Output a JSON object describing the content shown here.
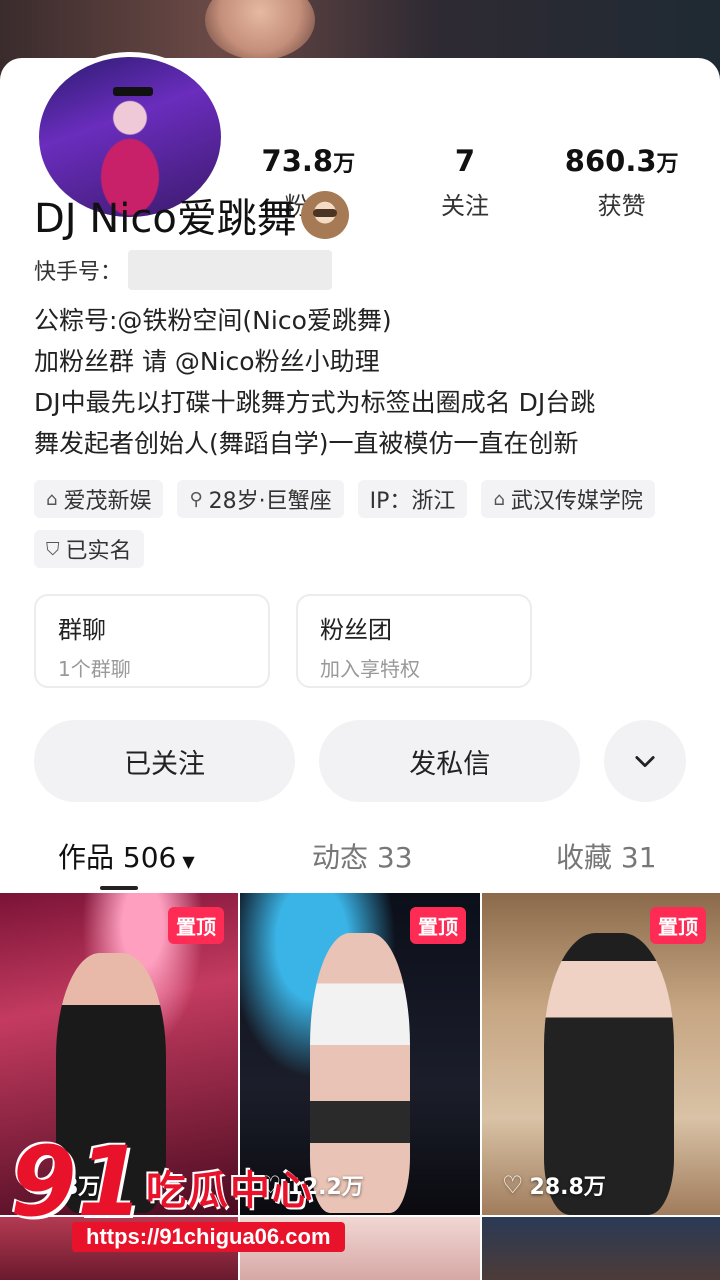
{
  "profile": {
    "name": "DJ Nico爱跳舞",
    "emoji_icon": "sloth-emoji",
    "kuaishou_label": "快手号：",
    "stats": [
      {
        "num": "73.8",
        "unit": "万",
        "label": "粉丝"
      },
      {
        "num": "7",
        "unit": "",
        "label": "关注"
      },
      {
        "num": "860.3",
        "unit": "万",
        "label": "获赞"
      }
    ],
    "bio": [
      "公粽号:@铁粉空间(Nico爱跳舞)",
      "加粉丝群 请 @Nico粉丝小助理",
      "DJ中最先以打碟十跳舞方式为标签出圈成名 DJ台跳",
      "舞发起者创始人(舞蹈自学)一直被模仿一直在创新"
    ],
    "tags": [
      {
        "icon": "building-icon",
        "glyph": "⌂",
        "label": "爱茂新娱"
      },
      {
        "icon": "gender-icon",
        "glyph": "⚲",
        "label": "28岁·巨蟹座"
      },
      {
        "icon": "",
        "glyph": "",
        "label": "IP：浙江"
      },
      {
        "icon": "school-icon",
        "glyph": "⌂",
        "label": "武汉传媒学院"
      },
      {
        "icon": "shield-icon",
        "glyph": "⛉",
        "label": "已实名"
      }
    ]
  },
  "cards": [
    {
      "title": "群聊",
      "sub": "1个群聊"
    },
    {
      "title": "粉丝团",
      "sub": "加入享特权"
    }
  ],
  "actions": {
    "follow": "已关注",
    "message": "发私信",
    "more_icon": "chevron-down-icon"
  },
  "tabs": [
    {
      "label": "作品 506",
      "active": true
    },
    {
      "label": "动态 33",
      "active": false
    },
    {
      "label": "收藏 31",
      "active": false
    }
  ],
  "videos": [
    {
      "pin": "置顶",
      "likes": "18万"
    },
    {
      "pin": "置顶",
      "likes": "12.2万"
    },
    {
      "pin": "置顶",
      "likes": "28.8万"
    }
  ],
  "watermark": {
    "num": "91",
    "cn": "吃瓜中心",
    "url": "https://91chigua06.com"
  },
  "colors": {
    "accent": "#fe2c55",
    "watermark": "#e8132a"
  }
}
